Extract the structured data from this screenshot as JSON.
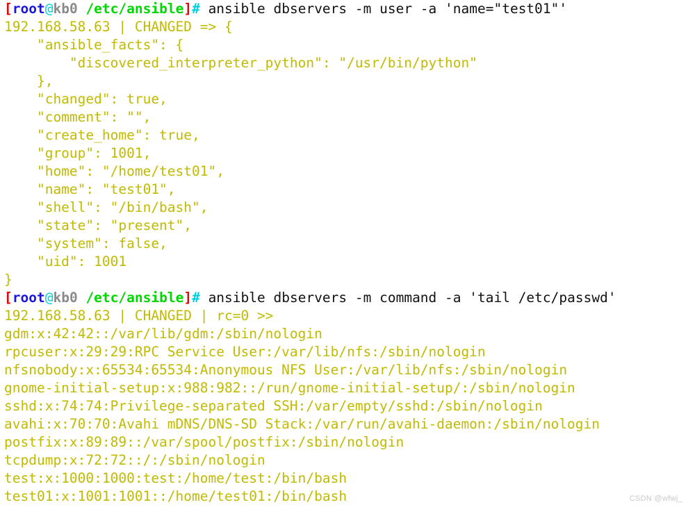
{
  "terminal": {
    "background_color": "#ffffff",
    "output_color": "#c2ba00",
    "command_color": "#111111",
    "prompt": {
      "bracket_open": "[",
      "user": "root",
      "at": "@",
      "host": "kb0",
      "path": " /etc/ansible",
      "bracket_close": "]",
      "sigil": "#",
      "colors": {
        "bracket": "#e8000c",
        "user": "#1a16e0",
        "at": "#00cfe0",
        "host": "#8a8a8a",
        "path": "#00d600",
        "sigil": "#00cfe0"
      }
    },
    "commands": {
      "first": " ansible dbservers -m user -a 'name=\"test01\"'",
      "second": " ansible dbservers -m command -a 'tail /etc/passwd'"
    },
    "output_block_1": [
      "192.168.58.63 | CHANGED => {",
      "    \"ansible_facts\": {",
      "        \"discovered_interpreter_python\": \"/usr/bin/python\"",
      "    },",
      "    \"changed\": true,",
      "    \"comment\": \"\",",
      "    \"create_home\": true,",
      "    \"group\": 1001,",
      "    \"home\": \"/home/test01\",",
      "    \"name\": \"test01\",",
      "    \"shell\": \"/bin/bash\",",
      "    \"state\": \"present\",",
      "    \"system\": false,",
      "    \"uid\": 1001",
      "}"
    ],
    "output_block_2": [
      "192.168.58.63 | CHANGED | rc=0 >>",
      "gdm:x:42:42::/var/lib/gdm:/sbin/nologin",
      "rpcuser:x:29:29:RPC Service User:/var/lib/nfs:/sbin/nologin",
      "nfsnobody:x:65534:65534:Anonymous NFS User:/var/lib/nfs:/sbin/nologin",
      "gnome-initial-setup:x:988:982::/run/gnome-initial-setup/:/sbin/nologin",
      "sshd:x:74:74:Privilege-separated SSH:/var/empty/sshd:/sbin/nologin",
      "avahi:x:70:70:Avahi mDNS/DNS-SD Stack:/var/run/avahi-daemon:/sbin/nologin",
      "postfix:x:89:89::/var/spool/postfix:/sbin/nologin",
      "tcpdump:x:72:72::/:/sbin/nologin",
      "test:x:1000:1000:test:/home/test:/bin/bash",
      "test01:x:1001:1001::/home/test01:/bin/bash"
    ]
  },
  "watermark": {
    "text": "CSDN @wfwj_"
  }
}
